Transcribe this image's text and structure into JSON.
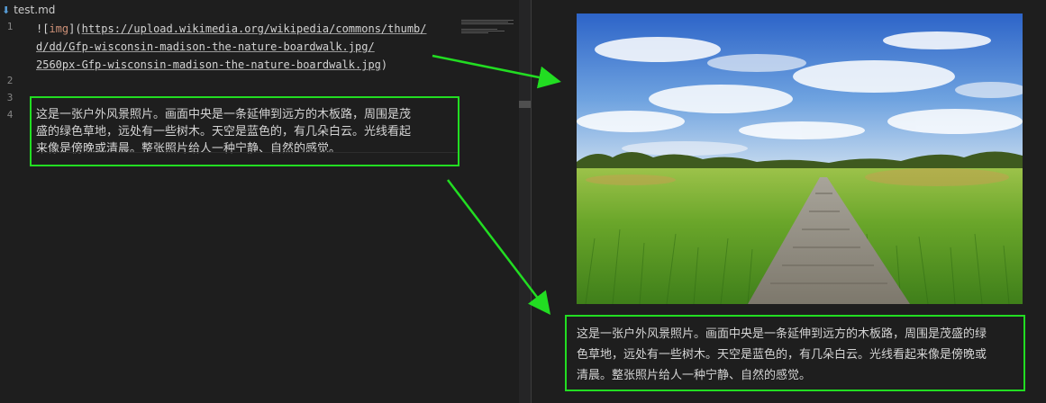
{
  "editor": {
    "tab_title": "test.md",
    "tab_icon": "markdown-file-icon",
    "line_numbers": [
      "1",
      "2",
      "3",
      "4"
    ],
    "code_line1_prefix": "![",
    "code_alt": "img",
    "code_line1_mid": "](",
    "code_url_part1": "https://upload.wikimedia.org/wikipedia/commons/thumb/",
    "code_url_part2": "d/dd/Gfp-wisconsin-madison-the-nature-boardwalk.jpg/",
    "code_url_part3": "2560px-Gfp-wisconsin-madison-the-nature-boardwalk.jpg",
    "code_line3_suffix": ")",
    "prose_lines": [
      "这是一张户外风景照片。画面中央是一条延伸到远方的木板路，周围是茂",
      "盛的绿色草地，远处有一些树木。天空是蓝色的，有几朵白云。光线看起",
      "来像是傍晚或清晨。整张照片给人一种宁静、自然的感觉。"
    ]
  },
  "preview": {
    "image_subject": "nature-boardwalk-photo",
    "text_lines": [
      "这是一张户外风景照片。画面中央是一条延伸到远方的木板路，周围是茂盛的绿",
      "色草地，远处有一些树木。天空是蓝色的，有几朵白云。光线看起来像是傍晚或",
      "清晨。整张照片给人一种宁静、自然的感觉。"
    ]
  },
  "colors": {
    "highlight": "#22dd22",
    "background": "#1e1e1e",
    "text": "#d4d4d4",
    "alt_text": "#ce9178"
  }
}
